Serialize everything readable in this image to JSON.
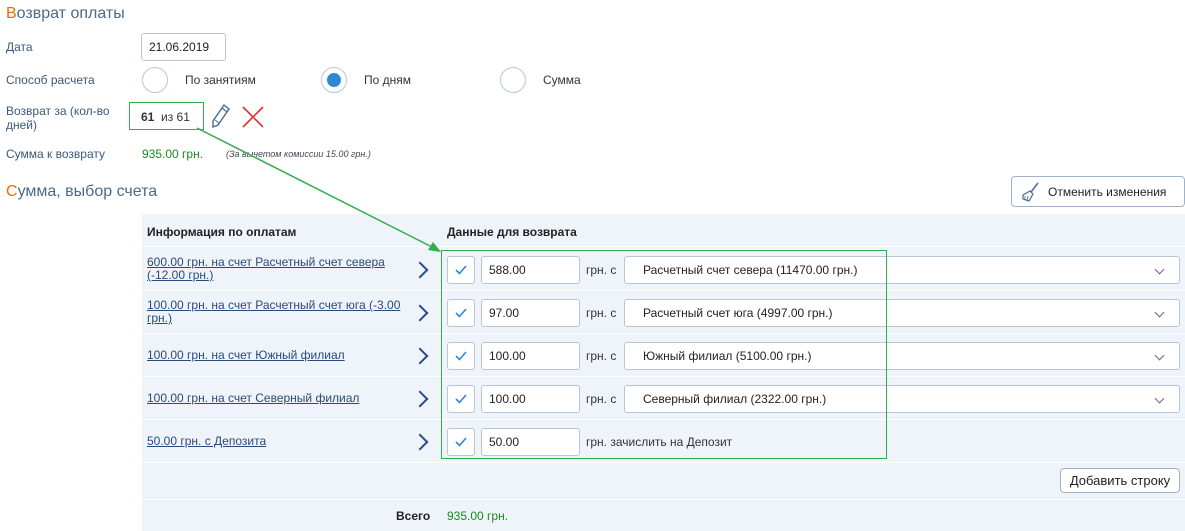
{
  "refund_section": {
    "title_first": "В",
    "title_rest": "озврат оплаты",
    "date_label": "Дата",
    "date_value": "21.06.2019",
    "method_label": "Способ расчета",
    "methods": [
      {
        "label": "По занятиям",
        "selected": false
      },
      {
        "label": "По дням",
        "selected": true
      },
      {
        "label": "Сумма",
        "selected": false
      }
    ],
    "days_label": "Возврат за (кол-во дней)",
    "days_value": "61",
    "days_of": "из 61",
    "amount_label": "Сумма к возврату",
    "amount_value": "935.00  грн.",
    "amount_note": "(За вычетом комиссии 15.00 грн.)"
  },
  "account_section": {
    "title_first": "С",
    "title_rest": "умма, выбор счета",
    "undo_button": "Отменить изменения"
  },
  "table": {
    "col_info": "Информация по оплатам",
    "col_refund": "Данные для возврата",
    "rows": [
      {
        "info": "600.00 грн. на счет Расчетный счет севера (-12.00 грн.)",
        "amount": "588.00",
        "unit": "грн. с",
        "account": "Расчетный счет севера (11470.00 грн.)"
      },
      {
        "info": "100.00 грн. на счет Расчетный счет юга (-3.00 грн.)",
        "amount": "97.00",
        "unit": "грн. с",
        "account": "Расчетный счет юга (4997.00 грн.)"
      },
      {
        "info": "100.00 грн. на счет Южный филиал",
        "amount": "100.00",
        "unit": "грн. с",
        "account": "Южный филиал (5100.00 грн.)"
      },
      {
        "info": "100.00 грн. на счет Северный филиал",
        "amount": "100.00",
        "unit": "грн. с",
        "account": "Северный филиал (2322.00 грн.)"
      },
      {
        "info": "50.00 грн. с Депозита",
        "amount": "50.00",
        "unit": "грн. зачислить на Депозит",
        "account": null
      }
    ],
    "add_row_button": "Добавить строку",
    "total_label": "Всего",
    "total_value": "935.00  грн."
  },
  "colors": {
    "accent_orange": "#f06a00",
    "link_blue": "#2a4a7a",
    "annotation_green": "#2fae4a",
    "amount_green": "#1a8a1a",
    "delete_red": "#e03030",
    "table_bg": "#eef4fa"
  },
  "icons": [
    "pencil-icon",
    "delete-x-icon",
    "broom-icon",
    "chevron-right-icon",
    "check-icon",
    "chevron-down-icon"
  ]
}
